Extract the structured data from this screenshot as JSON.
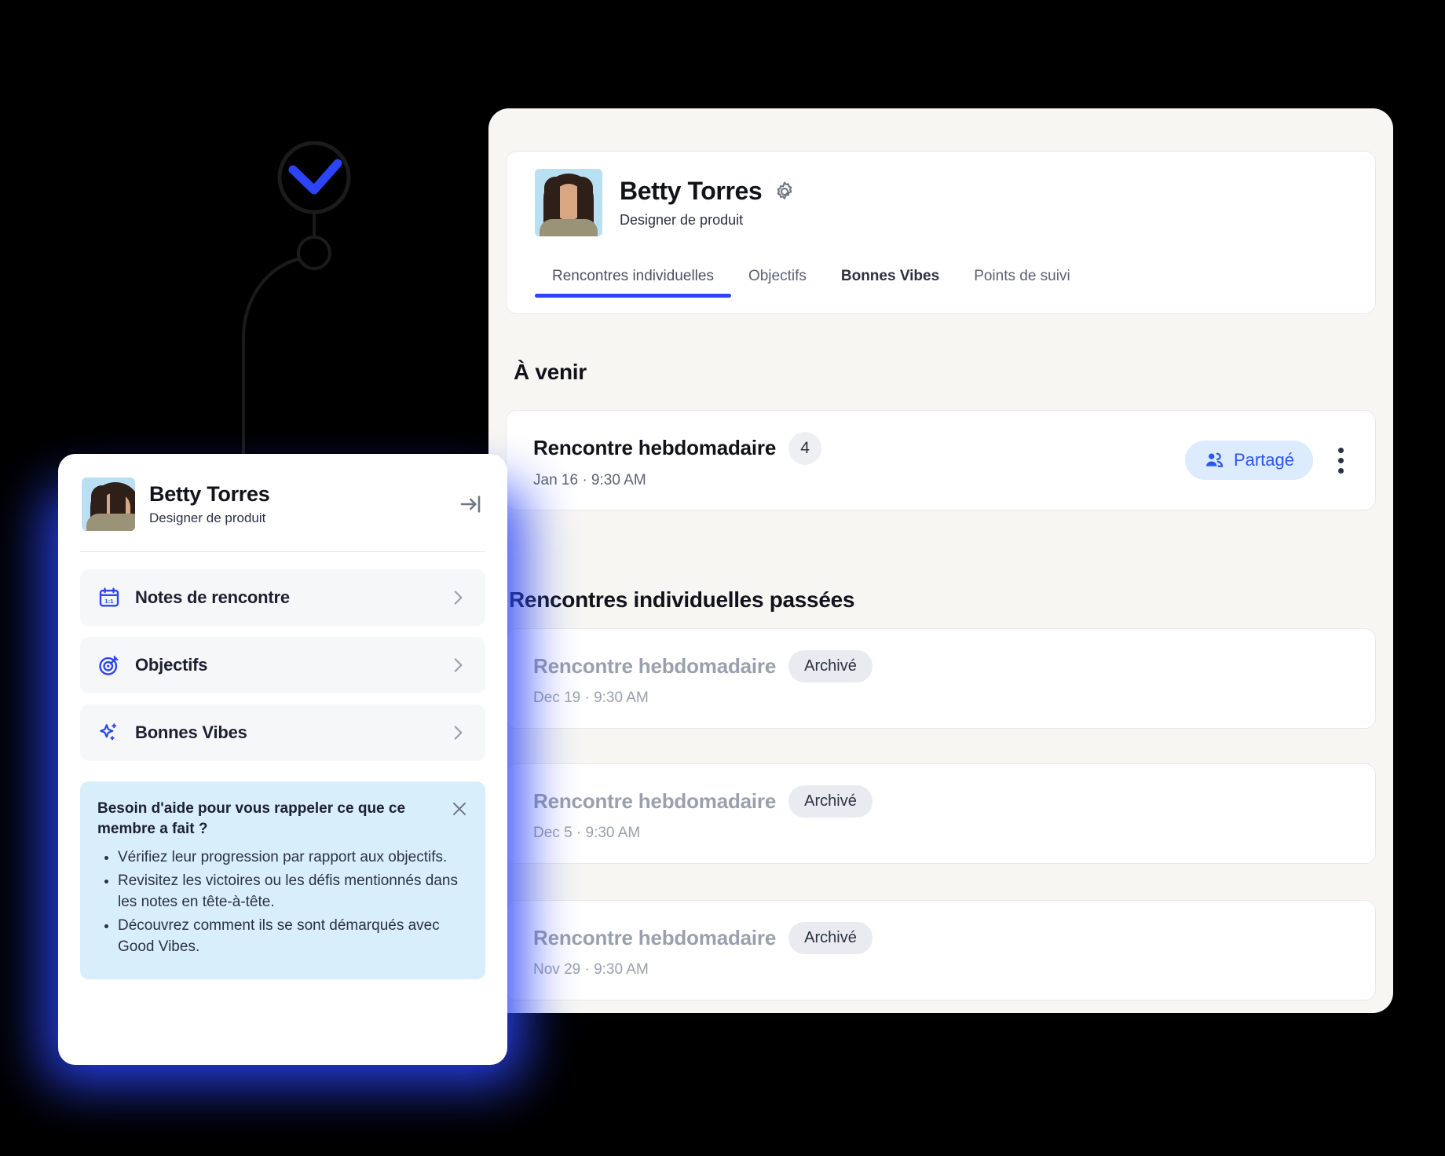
{
  "decor": {
    "check_icon": "check-circle-icon",
    "accent_color": "#2B44F5",
    "line_color": "#1B1B1B"
  },
  "background_panel": {
    "profile": {
      "name": "Betty Torres",
      "role": "Designer de produit",
      "settings_icon": "gear-icon",
      "avatar": "user-avatar"
    },
    "tabs": [
      {
        "label": "Rencontres individuelles",
        "active": true
      },
      {
        "label": "Objectifs",
        "active": false
      },
      {
        "label": "Bonnes Vibes",
        "active": false
      },
      {
        "label": "Points de suivi",
        "active": false
      }
    ],
    "upcoming": {
      "section_title": "À venir",
      "meeting": {
        "title": "Rencontre hebdomadaire",
        "count": "4",
        "date": "Jan 16 · 9:30 AM",
        "shared_label": "Partagé",
        "shared_icon": "people-icon",
        "menu_icon": "kebab-menu-icon"
      }
    },
    "past": {
      "section_title": "Rencontres individuelles passées",
      "meetings": [
        {
          "title": "Rencontre hebdomadaire",
          "status": "Archivé",
          "date": "Dec 19 · 9:30 AM"
        },
        {
          "title": "Rencontre hebdomadaire",
          "status": "Archivé",
          "date": "Dec 5 · 9:30 AM"
        },
        {
          "title": "Rencontre hebdomadaire",
          "status": "Archivé",
          "date": "Nov 29 · 9:30 AM"
        }
      ]
    }
  },
  "foreground_card": {
    "profile": {
      "name": "Betty Torres",
      "role": "Designer de produit",
      "collapse_icon": "collapse-panel-icon"
    },
    "menu_items": [
      {
        "label": "Notes de rencontre",
        "icon": "calendar-1on1-icon"
      },
      {
        "label": "Objectifs",
        "icon": "target-icon"
      },
      {
        "label": "Bonnes Vibes",
        "icon": "sparkles-icon"
      }
    ],
    "tip": {
      "title": "Besoin d'aide pour vous rappeler ce que ce membre a fait ?",
      "close_icon": "close-icon",
      "bullets": [
        "Vérifiez leur progression par rapport aux objectifs.",
        "Revisitez les victoires ou les défis mentionnés dans les notes en tête-à-tête.",
        "Découvrez comment ils se sont démarqués avec Good Vibes."
      ]
    }
  }
}
